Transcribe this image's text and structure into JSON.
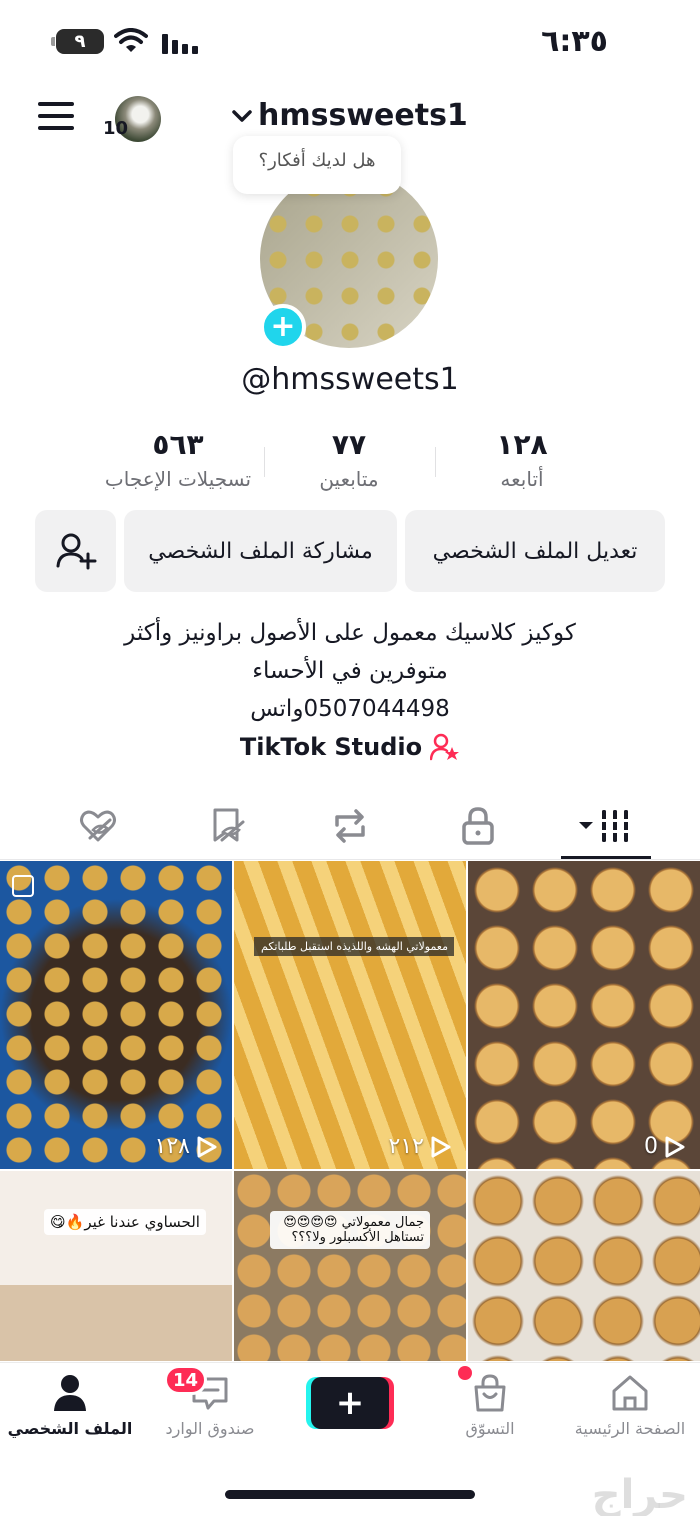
{
  "status_bar": {
    "time": "٦:٣٥",
    "battery": "٩"
  },
  "header": {
    "username": "hmssweets1",
    "avatar_badge": "10"
  },
  "profile": {
    "bubble_text": "هل لديك أفكار؟",
    "handle": "@hmssweets1",
    "stats": [
      {
        "value": "١٢٨",
        "label": "أتابعه"
      },
      {
        "value": "٧٧",
        "label": "متابعين"
      },
      {
        "value": "٥٦٣",
        "label": "تسجيلات الإعجاب"
      }
    ],
    "buttons": {
      "edit": "تعديل الملف الشخصي",
      "share": "مشاركة الملف الشخصي"
    },
    "bio": [
      "كوكيز كلاسيك معمول على الأصول براونيز وأكثر",
      "متوفرين في الأحساء",
      "0507044498واتس"
    ],
    "studio": "TikTok Studio"
  },
  "grid": [
    {
      "plays": "١٢٨"
    },
    {
      "plays": "٢١٢",
      "caption": "معمولاتي الهشه واللذيذه استقبل طلباتكم"
    },
    {
      "plays": "0"
    },
    {
      "caption": "الحساوي عندنا غير🔥😋"
    },
    {
      "caption": "جمال معمولاتي 😍😍😍😍 تستاهل الأكسبلور ولا؟؟؟"
    },
    {}
  ],
  "bottom_nav": {
    "home": "الصفحة الرئيسية",
    "shop": "التسوّق",
    "inbox": "صندوق الوارد",
    "inbox_badge": "14",
    "profile": "الملف الشخصي"
  },
  "watermark": "حراج",
  "colors": {
    "accent": "#fe2c55",
    "cyan": "#25f4ee",
    "plus_badge": "#20d5ec"
  }
}
